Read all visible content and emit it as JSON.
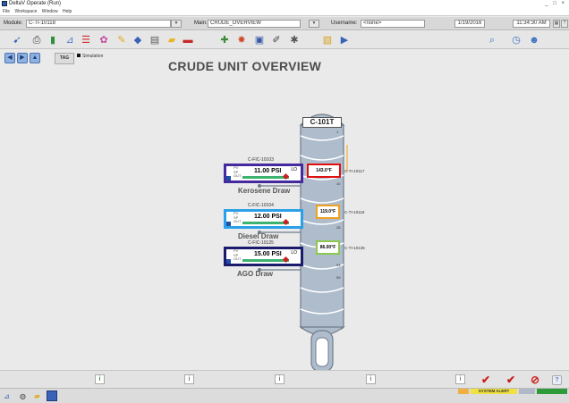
{
  "app": {
    "title": "DeltaV Operate (Run)",
    "controls": "_ □ ×"
  },
  "menu": [
    "File",
    "Workspace",
    "Window",
    "Help"
  ],
  "infobar": {
    "module_label": "Module:",
    "module_value": "C-TI-10118",
    "main_label": "Main:",
    "main_value": "CRUDE_OVERVIEW",
    "username_label": "Username:",
    "username_value": "<none>",
    "date": "1/19/2016",
    "time": "11:34:30 AM"
  },
  "nav": {
    "tag_label": "TAG",
    "simulation_label": "Simulation"
  },
  "display_title": "CRUDE UNIT OVERVIEW",
  "column": {
    "tag": "C-101T",
    "tray_numbers": [
      "1",
      "10",
      "28",
      "54",
      "59"
    ]
  },
  "controllers": [
    {
      "tag": "C-FIC-10103",
      "pv_label": "PV",
      "sp_label": "SP",
      "out_label": "OUT",
      "value": "11.00 PSI",
      "mode": "LO",
      "draw": "Kerosene Draw"
    },
    {
      "tag": "C-FIC-10104",
      "pv_label": "PV",
      "sp_label": "SP",
      "out_label": "OUT",
      "value": "12.00 PSI",
      "mode": "",
      "draw": "Diesel Draw"
    },
    {
      "tag": "C-FIC-10125",
      "pv_label": "PV",
      "sp_label": "SP",
      "out_label": "OUT",
      "value": "15.00 PSI",
      "mode": "LO",
      "draw": "AGO Draw"
    }
  ],
  "temps": [
    {
      "value": "143.0°F",
      "tag": "C-TI-10117",
      "color": "#e01010"
    },
    {
      "value": "119.0°F",
      "tag": "C-TI-10118",
      "color": "#f0a020"
    },
    {
      "value": "86.00°F",
      "tag": "C-TI-10135",
      "color": "#8cc850"
    }
  ],
  "status": {
    "info_glyph": "i",
    "help_glyph": "?"
  },
  "taskbar": {
    "system_alert": "SYSTEM ALERT"
  },
  "colors": {
    "kerosene_border": "#45299e",
    "diesel_border": "#2ba0e8",
    "ago_border": "#1b1b6e",
    "column_fill": "#aebccc"
  }
}
